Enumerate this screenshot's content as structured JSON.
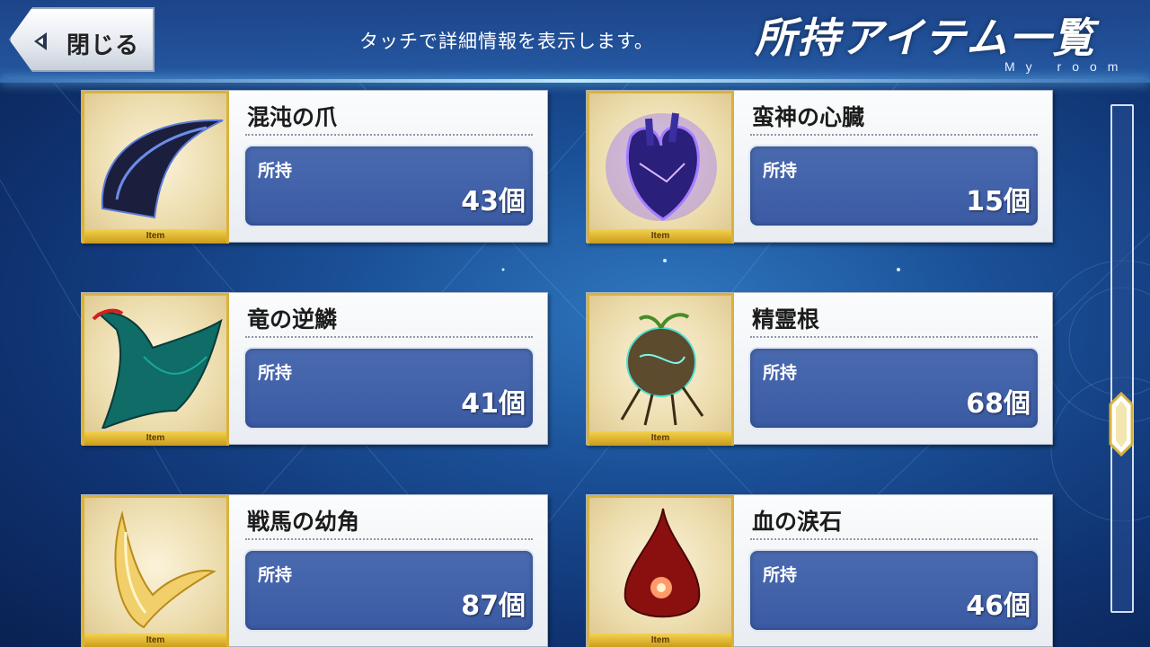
{
  "header": {
    "back_label": "閉じる",
    "hint": "タッチで詳細情報を表示します。",
    "title": "所持アイテム一覧",
    "subtitle": "My room"
  },
  "items": [
    {
      "name": "混沌の爪",
      "owned_label": "所持",
      "count": "43個",
      "tag": "Item",
      "icon": "claw-icon"
    },
    {
      "name": "蛮神の心臓",
      "owned_label": "所持",
      "count": "15個",
      "tag": "Item",
      "icon": "heart-icon"
    },
    {
      "name": "竜の逆鱗",
      "owned_label": "所持",
      "count": "41個",
      "tag": "Item",
      "icon": "dragon-scale-icon"
    },
    {
      "name": "精霊根",
      "owned_label": "所持",
      "count": "68個",
      "tag": "Item",
      "icon": "root-icon"
    },
    {
      "name": "戦馬の幼角",
      "owned_label": "所持",
      "count": "87個",
      "tag": "Item",
      "icon": "horn-icon"
    },
    {
      "name": "血の涙石",
      "owned_label": "所持",
      "count": "46個",
      "tag": "Item",
      "icon": "blood-tear-icon"
    }
  ],
  "colors": {
    "background": "#1a4f96",
    "count_box": "#3f5fa8",
    "item_tag": "#e2b93a"
  }
}
